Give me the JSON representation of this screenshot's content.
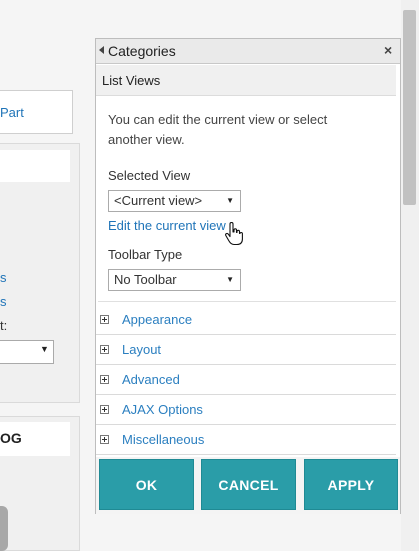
{
  "background": {
    "part_link": "Part",
    "link_1": "s",
    "link_2": "s",
    "label": "t:",
    "og_text": "OG"
  },
  "pane": {
    "title": "Categories",
    "collapse_icon": "left-triangle-icon",
    "close_icon": "×",
    "section_title": "List Views",
    "description": "You can edit the current view or select another view.",
    "selected_view_label": "Selected View",
    "selected_view_value": "<Current view>",
    "edit_link": "Edit the current view",
    "toolbar_type_label": "Toolbar Type",
    "toolbar_type_value": "No Toolbar",
    "accordion": [
      {
        "label": "Appearance"
      },
      {
        "label": "Layout"
      },
      {
        "label": "Advanced"
      },
      {
        "label": "AJAX Options"
      },
      {
        "label": "Miscellaneous"
      }
    ],
    "buttons": {
      "ok": "OK",
      "cancel": "CANCEL",
      "apply": "APPLY"
    }
  },
  "colors": {
    "accent_button": "#2a9da8",
    "link": "#1f74b8",
    "accordion_text": "#2b7fc0"
  }
}
